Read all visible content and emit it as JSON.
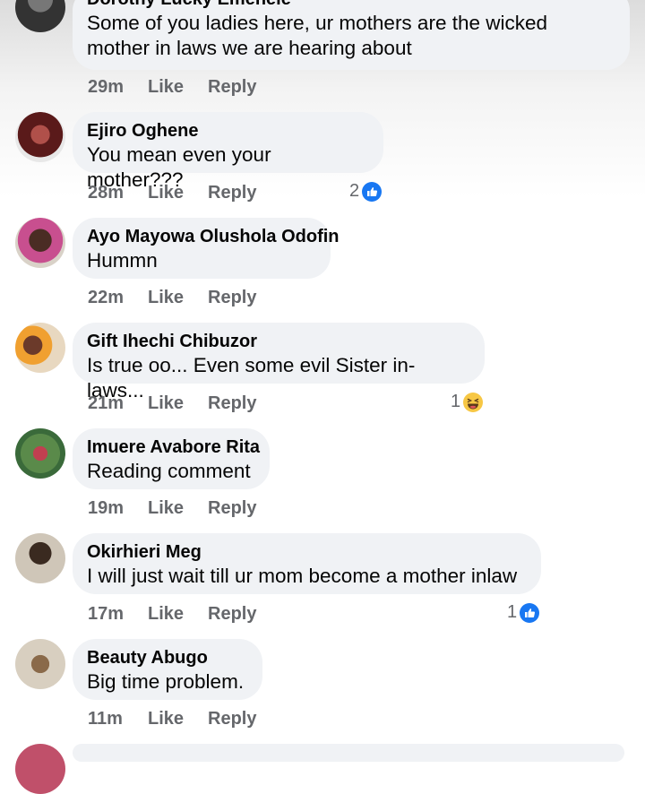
{
  "comments": [
    {
      "author": "Dorothy Lucky Emenele",
      "text": "Some of you ladies here, ur mothers are the wicked mother in laws we are hearing about",
      "time": "29m",
      "like": "Like",
      "reply": "Reply",
      "reactions": null
    },
    {
      "author": "Ejiro Oghene",
      "text": "You mean even your mother???",
      "time": "28m",
      "like": "Like",
      "reply": "Reply",
      "reactions": {
        "count": "2",
        "icon": "like-icon"
      }
    },
    {
      "author": "Ayo Mayowa Olushola Odofin",
      "text": "Hummn",
      "time": "22m",
      "like": "Like",
      "reply": "Reply",
      "reactions": null
    },
    {
      "author": "Gift Ihechi Chibuzor",
      "text": "Is true oo... Even some evil Sister in-laws...",
      "time": "21m",
      "like": "Like",
      "reply": "Reply",
      "reactions": {
        "count": "1",
        "icon": "haha-icon"
      }
    },
    {
      "author": "Imuere Avabore Rita",
      "text": "Reading comment",
      "time": "19m",
      "like": "Like",
      "reply": "Reply",
      "reactions": null
    },
    {
      "author": "Okirhieri Meg",
      "text": "I will just wait till ur mom become a mother inlaw",
      "time": "17m",
      "like": "Like",
      "reply": "Reply",
      "reactions": {
        "count": "1",
        "icon": "like-icon"
      }
    },
    {
      "author": "Beauty Abugo",
      "text": "Big time problem.",
      "time": "11m",
      "like": "Like",
      "reply": "Reply",
      "reactions": null
    }
  ],
  "colors": {
    "bubble": "#f0f2f5",
    "like_blue": "#1877f2",
    "meta_gray": "#65676b",
    "haha_yellow": "#f7c744"
  }
}
